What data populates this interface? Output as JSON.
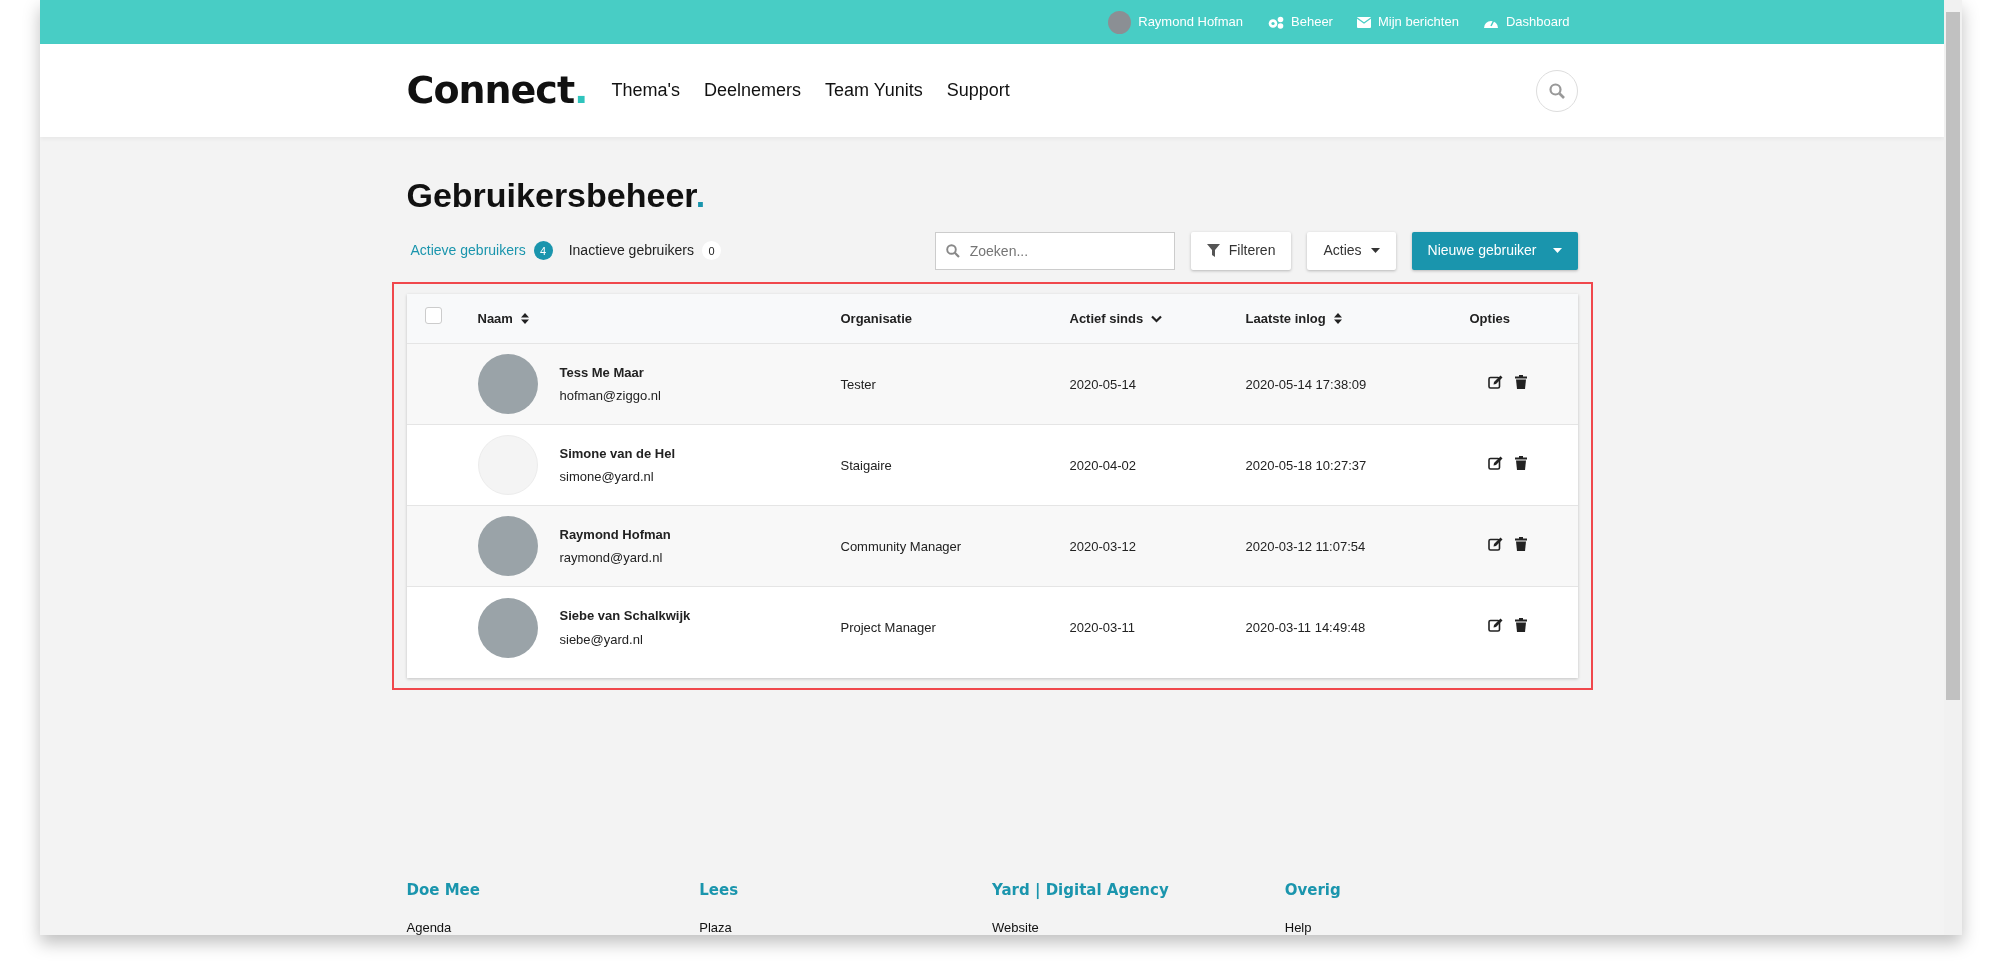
{
  "top_bar": {
    "user": {
      "name": "Raymond Hofman",
      "avatar": {
        "kind": "photo"
      }
    },
    "links": [
      {
        "label": "Beheer",
        "kind": "admin"
      },
      {
        "label": "Mijn berichten",
        "kind": "messages"
      },
      {
        "label": "Dashboard",
        "kind": "dashboard"
      }
    ]
  },
  "header": {
    "logo": {
      "text": "Connect",
      "mark": "."
    },
    "nav": [
      "Thema's",
      "Deelnemers",
      "Team Yunits",
      "Support"
    ]
  },
  "page": {
    "title": "Gebruikersbeheer",
    "title_mark": ".",
    "tabs": [
      {
        "label": "Actieve gebruikers",
        "count": "4",
        "selected": true
      },
      {
        "label": "Inactieve gebruikers",
        "count": "0",
        "selected": false
      }
    ],
    "search": {
      "placeholder": "Zoeken..."
    },
    "buttons": [
      {
        "label": "Filteren",
        "kind": "filter"
      },
      {
        "label": "Acties",
        "kind": "dropdown"
      },
      {
        "label": "Nieuwe gebruiker",
        "kind": "primary-dropdown"
      }
    ]
  },
  "table": {
    "select_all": {
      "checked": false
    },
    "columns": [
      {
        "label": "Naam",
        "kind": "sortable"
      },
      {
        "label": "Organisatie",
        "kind": "plain"
      },
      {
        "label": "Actief sinds",
        "kind": "sorted"
      },
      {
        "label": "Laatste inlog",
        "kind": "sortable"
      },
      {
        "label": "Opties",
        "kind": "plain"
      }
    ],
    "rows": [
      {
        "name": "Tess Me Maar",
        "email": "hofman@ziggo.nl",
        "avatar": {
          "kind": "photo"
        },
        "organisation": "Tester",
        "active_since": "2020-05-14",
        "last_login": "2020-05-14 17:38:09"
      },
      {
        "name": "Simone van de Hel",
        "email": "simone@yard.nl",
        "avatar": {
          "kind": "empty"
        },
        "organisation": "Staigaire",
        "active_since": "2020-04-02",
        "last_login": "2020-05-18 10:27:37"
      },
      {
        "name": "Raymond Hofman",
        "email": "raymond@yard.nl",
        "avatar": {
          "kind": "photo"
        },
        "organisation": "Community Manager",
        "active_since": "2020-03-12",
        "last_login": "2020-03-12 11:07:54"
      },
      {
        "name": "Siebe van Schalkwijk",
        "email": "siebe@yard.nl",
        "avatar": {
          "kind": "photo"
        },
        "organisation": "Project Manager",
        "active_since": "2020-03-11",
        "last_login": "2020-03-11 14:49:48"
      }
    ]
  },
  "footer": [
    {
      "title": "Doe Mee",
      "links": [
        "Agenda"
      ]
    },
    {
      "title": "Lees",
      "links": [
        "Plaza"
      ]
    },
    {
      "title": "Yard | Digital Agency",
      "links": [
        "Website"
      ]
    },
    {
      "title": "Overig",
      "links": [
        "Help"
      ]
    }
  ]
}
